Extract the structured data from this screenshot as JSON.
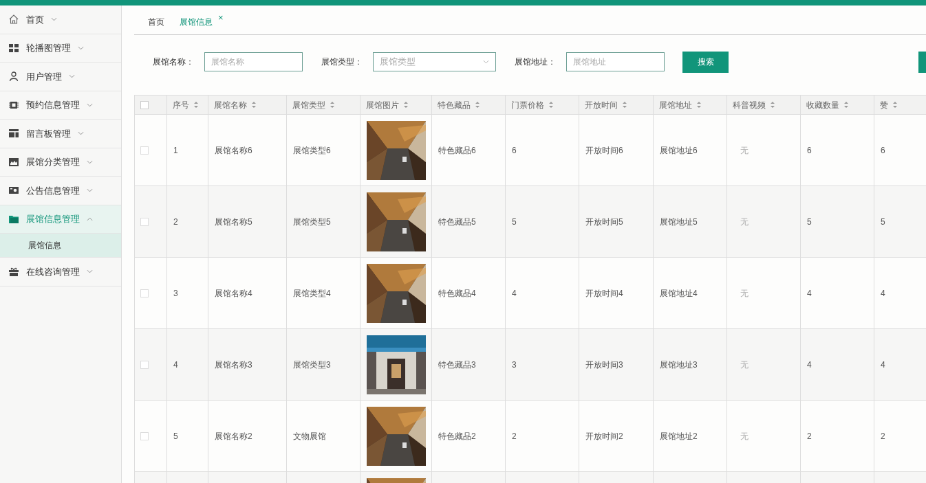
{
  "sidebar": {
    "items": [
      {
        "label": "首页",
        "expanded": false,
        "selected": false
      },
      {
        "label": "轮播图管理",
        "expanded": false,
        "selected": false
      },
      {
        "label": "用户管理",
        "expanded": false,
        "selected": false
      },
      {
        "label": "预约信息管理",
        "expanded": false,
        "selected": false
      },
      {
        "label": "留言板管理",
        "expanded": false,
        "selected": false
      },
      {
        "label": "展馆分类管理",
        "expanded": false,
        "selected": false
      },
      {
        "label": "公告信息管理",
        "expanded": false,
        "selected": false
      },
      {
        "label": "展馆信息管理",
        "expanded": true,
        "selected": true,
        "children": [
          {
            "label": "展馆信息",
            "selected": true
          }
        ]
      },
      {
        "label": "在线咨询管理",
        "expanded": false,
        "selected": false
      }
    ]
  },
  "tabs": [
    {
      "label": "首页",
      "selected": false,
      "closable": false
    },
    {
      "label": "展馆信息",
      "selected": true,
      "closable": true,
      "close": "×"
    }
  ],
  "filters": [
    {
      "label": "展馆名称：",
      "kind": "text",
      "placeholder": "展馆名称"
    },
    {
      "label": "展馆类型：",
      "kind": "select",
      "placeholder": "展馆类型"
    },
    {
      "label": "展馆地址：",
      "kind": "text",
      "placeholder": "展馆地址"
    }
  ],
  "search_button": "搜索",
  "table": {
    "all_checked": false,
    "columns": [
      "序号",
      "展馆名称",
      "展馆类型",
      "展馆图片",
      "特色藏品",
      "门票价格",
      "开放时间",
      "展馆地址",
      "科普视频",
      "收藏数量",
      "赞"
    ],
    "rows": [
      {
        "checked": false,
        "cells": [
          "1",
          "展馆名称6",
          "展馆类型6",
          {
            "kind": "picture"
          },
          "特色藏品6",
          "6",
          "开放时间6",
          "展馆地址6",
          "无",
          "6",
          "6"
        ]
      },
      {
        "checked": false,
        "cells": [
          "2",
          "展馆名称5",
          "展馆类型5",
          {
            "kind": "picture"
          },
          "特色藏品5",
          "5",
          "开放时间5",
          "展馆地址5",
          "无",
          "5",
          "5"
        ]
      },
      {
        "checked": false,
        "cells": [
          "3",
          "展馆名称4",
          "展馆类型4",
          {
            "kind": "picture"
          },
          "特色藏品4",
          "4",
          "开放时间4",
          "展馆地址4",
          "无",
          "4",
          "4"
        ]
      },
      {
        "checked": false,
        "cells": [
          "4",
          "展馆名称3",
          "展馆类型3",
          {
            "kind": "picture"
          },
          "特色藏品3",
          "3",
          "开放时间3",
          "展馆地址3",
          "无",
          "4",
          "4"
        ]
      },
      {
        "checked": false,
        "cells": [
          "5",
          "展馆名称2",
          "文物展馆",
          {
            "kind": "picture"
          },
          "特色藏品2",
          "2",
          "开放时间2",
          "展馆地址2",
          "无",
          "2",
          "2"
        ]
      },
      {
        "cells": [
          null,
          null,
          null,
          {
            "kind": "picture"
          },
          null,
          null,
          null,
          null,
          null,
          null,
          null
        ]
      }
    ]
  }
}
